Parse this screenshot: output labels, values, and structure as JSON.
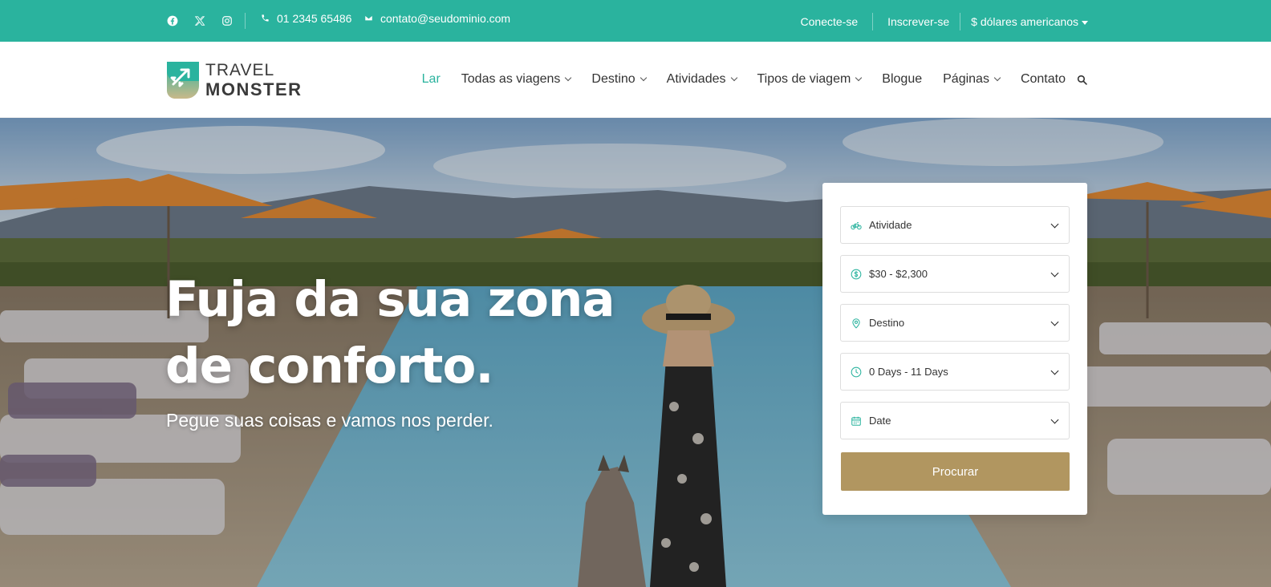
{
  "colors": {
    "brand_teal": "#2ab39e",
    "button_gold": "#b19660",
    "text_dark": "#333333"
  },
  "topbar": {
    "social_icons": [
      "facebook-icon",
      "x-icon",
      "instagram-icon"
    ],
    "phone": "01 2345 65486",
    "email": "contato@seudominio.com",
    "login": "Conecte-se",
    "register": "Inscrever-se",
    "currency": "$ dólares americanos"
  },
  "logo": {
    "line1": "TRAVEL",
    "line2": "MONSTER"
  },
  "nav": {
    "items": [
      {
        "label": "Lar",
        "active": true,
        "dropdown": false
      },
      {
        "label": "Todas as viagens",
        "dropdown": true
      },
      {
        "label": "Destino",
        "dropdown": true
      },
      {
        "label": "Atividades",
        "dropdown": true
      },
      {
        "label": "Tipos de viagem",
        "dropdown": true
      },
      {
        "label": "Blogue",
        "dropdown": false
      },
      {
        "label": "Páginas",
        "dropdown": true
      },
      {
        "label": "Contato",
        "dropdown": false
      }
    ]
  },
  "hero": {
    "title_line1": "Fuja da sua zona",
    "title_line2": "de conforto.",
    "subtitle": "Pegue suas coisas e vamos nos perder."
  },
  "search_form": {
    "fields": [
      {
        "icon": "bicycle-icon",
        "value": "Atividade"
      },
      {
        "icon": "dollar-circle-icon",
        "value": "$30 - $2,300"
      },
      {
        "icon": "map-pin-icon",
        "value": "Destino"
      },
      {
        "icon": "clock-icon",
        "value": "0 Days - 11 Days"
      },
      {
        "icon": "calendar-icon",
        "value": "Date"
      }
    ],
    "submit_label": "Procurar"
  }
}
